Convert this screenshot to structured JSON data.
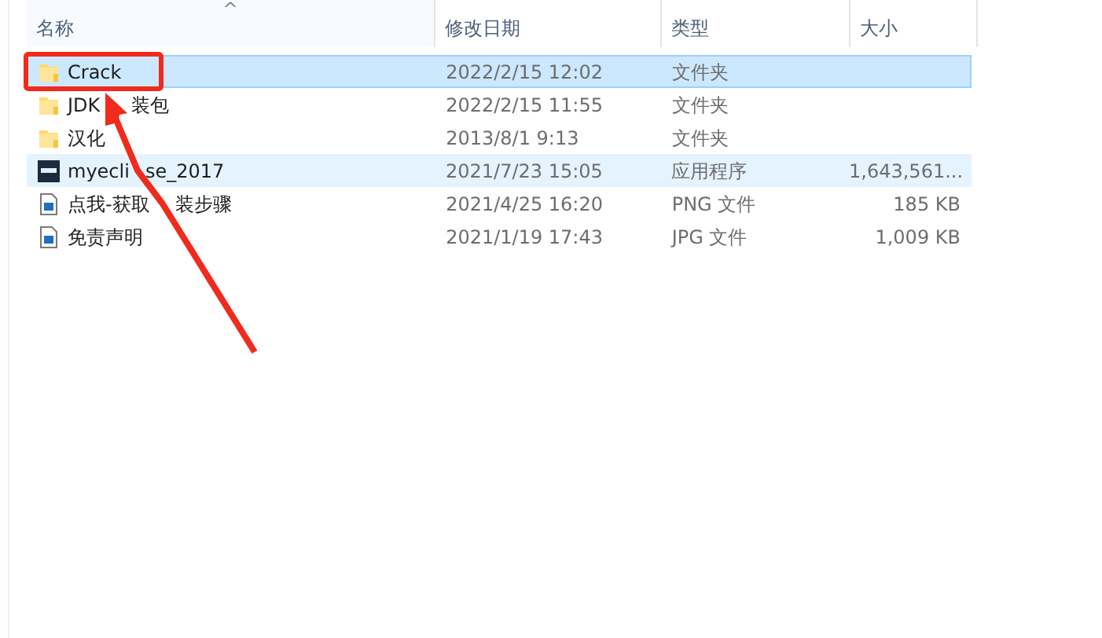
{
  "columns": [
    {
      "label": "名称",
      "sorted": true
    },
    {
      "label": "修改日期",
      "sorted": false
    },
    {
      "label": "类型",
      "sorted": false
    },
    {
      "label": "大小",
      "sorted": false
    }
  ],
  "sort_indicator": "^",
  "rows": [
    {
      "kind": "folder",
      "name_parts": [
        "Crack"
      ],
      "date": "2022/2/15 12:02",
      "type": "文件夹",
      "selected": true,
      "hovered": false
    },
    {
      "kind": "folder",
      "name_parts": [
        "JDK",
        "装包"
      ],
      "date": "2022/2/15 11:55",
      "type": "文件夹",
      "selected": false,
      "hovered": false
    },
    {
      "kind": "folder",
      "name_parts": [
        "汉化"
      ],
      "date": "2013/8/1 9:13",
      "type": "文件夹",
      "selected": false,
      "hovered": false
    },
    {
      "kind": "app",
      "name_parts": [
        "myecli",
        "se_2017"
      ],
      "date": "2021/7/23 15:05",
      "type": "应用程序",
      "size": "1,643,561...",
      "selected": false,
      "hovered": true
    },
    {
      "kind": "image",
      "name_parts": [
        "点我-获取",
        "装步骤"
      ],
      "date": "2021/4/25 16:20",
      "type": "PNG 文件",
      "size": "185 KB",
      "selected": false,
      "hovered": false
    },
    {
      "kind": "image",
      "name_parts": [
        "免责声明"
      ],
      "date": "2021/1/19 17:43",
      "type": "JPG 文件",
      "size": "1,009 KB",
      "selected": false,
      "hovered": false
    }
  ]
}
